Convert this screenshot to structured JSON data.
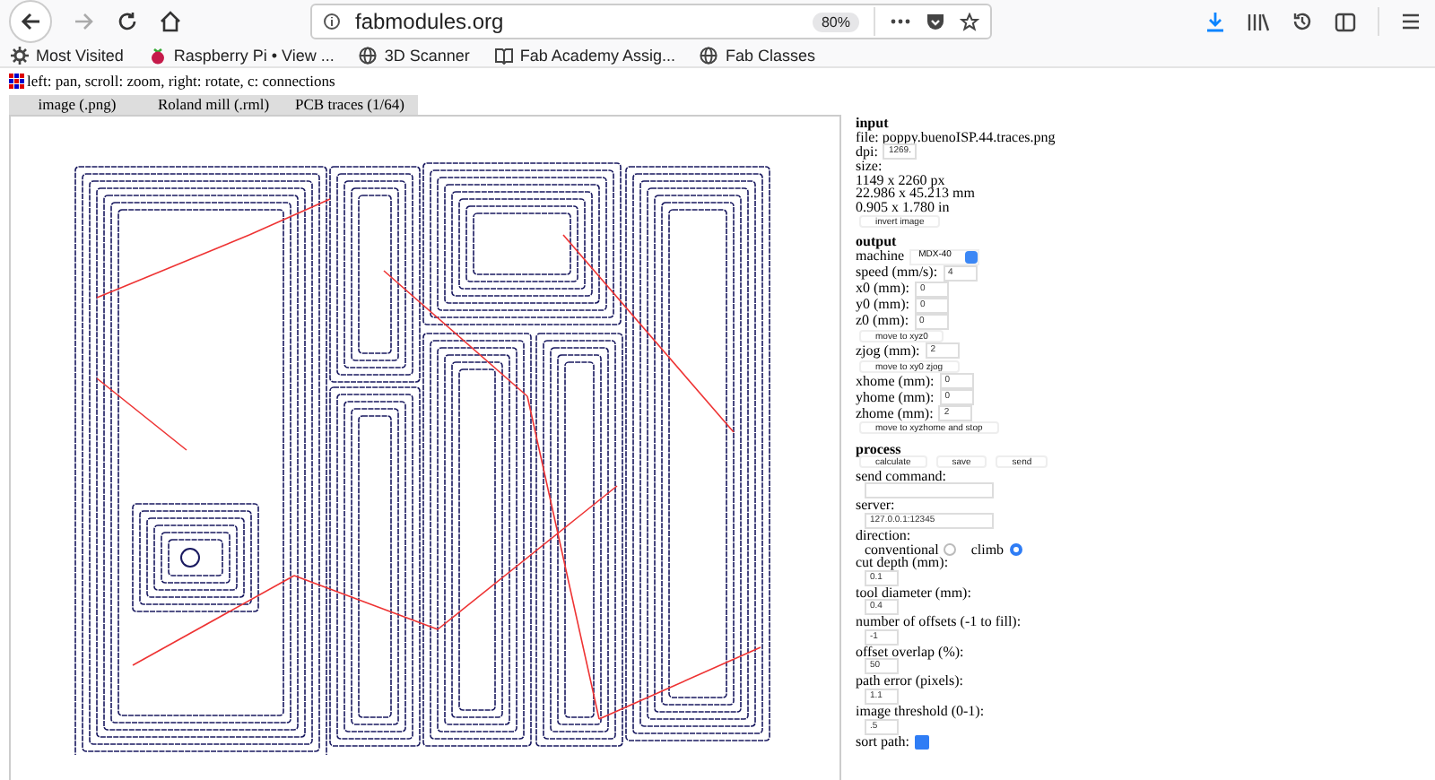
{
  "browser": {
    "url": "fabmodules.org",
    "zoom": "80%",
    "bookmarks": [
      {
        "label": "Most Visited"
      },
      {
        "label": "Raspberry Pi • View ..."
      },
      {
        "label": "3D Scanner"
      },
      {
        "label": "Fab Academy Assig..."
      },
      {
        "label": "Fab Classes"
      }
    ]
  },
  "hint": "left: pan, scroll: zoom, right: rotate, c: connections",
  "tabs": [
    {
      "label": "image (.png)"
    },
    {
      "label": "Roland mill (.rml)"
    },
    {
      "label": "PCB traces (1/64)"
    }
  ],
  "sections": [
    {
      "title": "input",
      "rows": [
        {
          "kind": "text",
          "text": "file: poppy.buenoISP.44.traces.png"
        },
        {
          "kind": "field",
          "label": "dpi:",
          "value": "1269."
        },
        {
          "kind": "text",
          "text": "size:"
        },
        {
          "kind": "text",
          "text": "1149 x 2260 px"
        },
        {
          "kind": "text",
          "text": "22.986 x 45.213 mm"
        },
        {
          "kind": "text",
          "text": "0.905 x 1.780 in"
        },
        {
          "kind": "button",
          "label": "invert image"
        }
      ]
    },
    {
      "title": "output",
      "rows": [
        {
          "kind": "select",
          "label": "machine",
          "value": "MDX-40"
        },
        {
          "kind": "field",
          "label": "speed (mm/s):",
          "value": "4"
        },
        {
          "kind": "field",
          "label": "x0 (mm):",
          "value": "0"
        },
        {
          "kind": "field",
          "label": "y0 (mm):",
          "value": "0"
        },
        {
          "kind": "field",
          "label": "z0 (mm):",
          "value": "0"
        },
        {
          "kind": "button",
          "label": "move to xyz0"
        },
        {
          "kind": "field",
          "label": "zjog (mm):",
          "value": "2"
        },
        {
          "kind": "button",
          "label": "move to xy0 zjog"
        },
        {
          "kind": "field",
          "label": "xhome (mm):",
          "value": "0"
        },
        {
          "kind": "field",
          "label": "yhome (mm):",
          "value": "0"
        },
        {
          "kind": "field",
          "label": "zhome (mm):",
          "value": "2"
        },
        {
          "kind": "button",
          "label": "move to xyzhome and stop"
        }
      ]
    },
    {
      "title": "process",
      "rows": [
        {
          "kind": "buttons",
          "labels": [
            "calculate",
            "save",
            "send"
          ]
        },
        {
          "kind": "wide",
          "label": "send command:"
        },
        {
          "kind": "wide",
          "label": "server:",
          "value": "127.0.0.1:12345"
        },
        {
          "kind": "text",
          "text": "direction:"
        },
        {
          "kind": "radios",
          "options": [
            {
              "label": "conventional",
              "selected": false
            },
            {
              "label": "climb",
              "selected": true
            }
          ]
        },
        {
          "kind": "below",
          "label": "cut depth (mm):",
          "value": "0.1"
        },
        {
          "kind": "below",
          "label": "tool diameter (mm):",
          "value": "0.4"
        },
        {
          "kind": "below",
          "label": "number of offsets (-1 to fill):",
          "value": "-1"
        },
        {
          "kind": "below",
          "label": "offset overlap (%):",
          "value": "50"
        },
        {
          "kind": "below",
          "label": "path error (pixels):",
          "value": "1.1"
        },
        {
          "kind": "below",
          "label": "image threshold (0-1):",
          "value": ".5"
        },
        {
          "kind": "checkbox",
          "label": "sort path:",
          "checked": true
        }
      ]
    }
  ]
}
